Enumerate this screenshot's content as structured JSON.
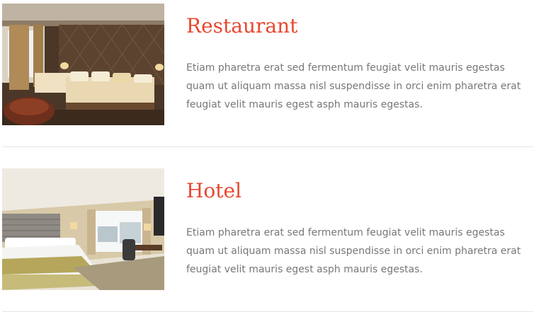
{
  "theme": {
    "accent": "#e8472f",
    "text": "#777777",
    "divider": "#e6e6e6"
  },
  "items": [
    {
      "title": "Restaurant",
      "description": "Etiam pharetra erat sed fermentum feugiat velit mauris egestas quam ut aliquam massa nisl suspendisse in orci enim pharetra erat feugiat velit mauris egest asph mauris egestas.",
      "image": "hotel-room-photo"
    },
    {
      "title": "Hotel",
      "description": "Etiam pharetra erat sed fermentum feugiat velit mauris egestas quam ut aliquam massa nisl suspendisse in orci enim pharetra erat feugiat velit mauris egest asph mauris egestas.",
      "image": "hotel-room-photo"
    }
  ]
}
